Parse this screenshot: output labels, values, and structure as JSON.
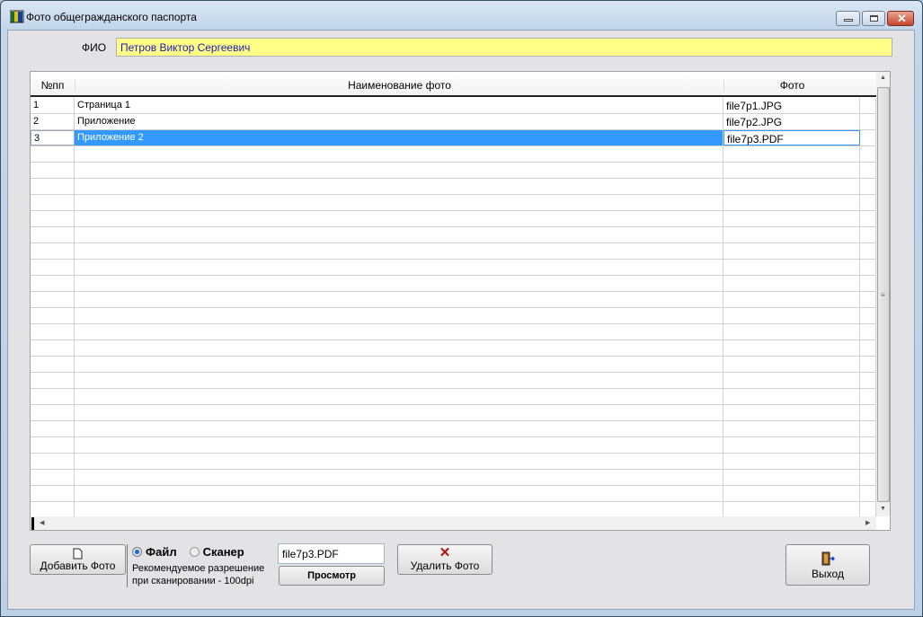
{
  "window": {
    "title": "Фото общегражданского паспорта"
  },
  "fio": {
    "label": "ФИО",
    "value": "Петров Виктор Сергеевич"
  },
  "table": {
    "headers": [
      "№пп",
      "Наименование фото",
      "Фото"
    ],
    "rows": [
      {
        "num": "1",
        "name": "Страница 1",
        "file": "file7p1.JPG"
      },
      {
        "num": "2",
        "name": "Приложение",
        "file": "file7p2.JPG"
      },
      {
        "num": "3",
        "name": "Приложение 2",
        "file": "file7p3.PDF",
        "selected": true
      }
    ],
    "empty_rows": 23
  },
  "bottom": {
    "add_label": "Добавить Фото",
    "radio_file": "Файл",
    "radio_scanner": "Сканер",
    "hint1": "Рекомендуемое разрешение",
    "hint2": "при сканировании - 100dpi",
    "file_value": "file7p3.PDF",
    "view_label": "Просмотр",
    "delete_label": "Удалить Фото",
    "exit_label": "Выход"
  }
}
